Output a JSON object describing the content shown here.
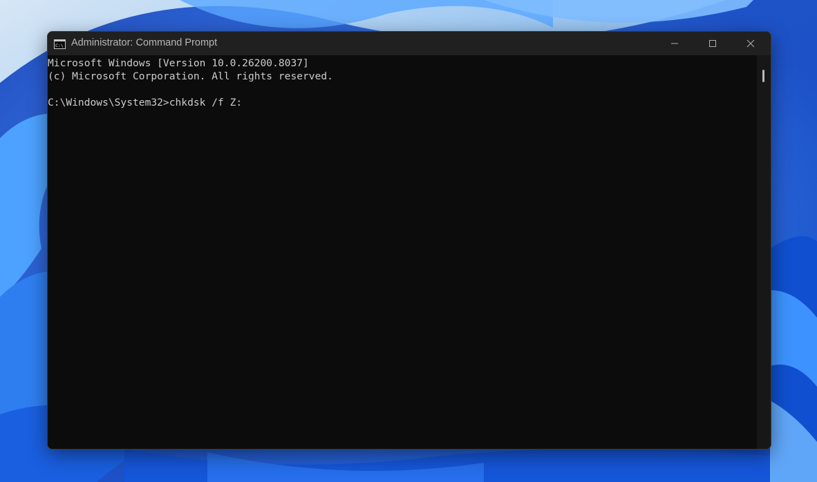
{
  "window": {
    "title": "Administrator: Command Prompt",
    "app_icon": "command-prompt-icon",
    "controls": {
      "minimize": "minimize-icon",
      "maximize": "maximize-icon",
      "close": "close-icon"
    }
  },
  "console": {
    "lines": [
      "Microsoft Windows [Version 10.0.26200.8037]",
      "(c) Microsoft Corporation. All rights reserved.",
      "",
      "C:\\Windows\\System32>chkdsk /f Z:"
    ]
  },
  "colors": {
    "console_background": "#0c0c0c",
    "console_text": "#cccccc",
    "titlebar": "#202020",
    "wallpaper_accent": "#1e5bd8"
  }
}
